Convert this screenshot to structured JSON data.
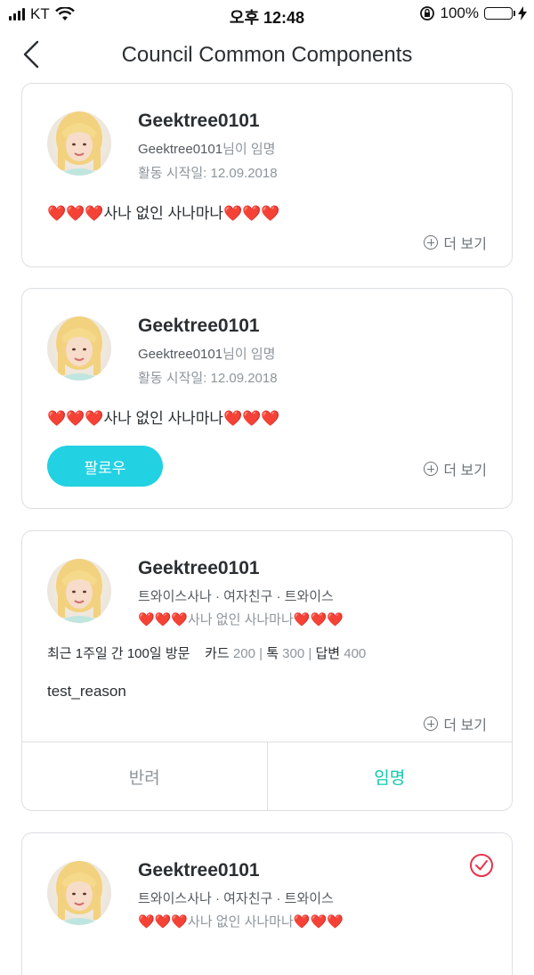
{
  "status_bar": {
    "carrier": "KT",
    "time": "오후 12:48",
    "battery": "100%",
    "icons": [
      "signal-icon",
      "wifi-icon",
      "orientation-lock-icon",
      "battery-icon",
      "charging-icon"
    ]
  },
  "nav": {
    "title": "Council Common Components",
    "back_icon": "chevron-left-icon"
  },
  "cards": [
    {
      "name": "Geektree0101",
      "appointed_by": "Geektree0101",
      "appointed_suffix": "님이 임명",
      "activity_start": "활동 시작일: 12.09.2018",
      "description": "❤️❤️❤️사나 없인 사나마나❤️❤️❤️",
      "more_label": "더 보기"
    },
    {
      "name": "Geektree0101",
      "appointed_by": "Geektree0101",
      "appointed_suffix": "님이 임명",
      "activity_start": "활동 시작일: 12.09.2018",
      "description": "❤️❤️❤️사나 없인 사나마나❤️❤️❤️",
      "follow_label": "팔로우",
      "more_label": "더 보기"
    },
    {
      "name": "Geektree0101",
      "tags": "트와이스사나 · 여자친구 · 트와이스",
      "bio": "❤️❤️❤️사나 없인 사나마나❤️❤️❤️",
      "stats": {
        "visits": "최근 1주일 간 100일 방문",
        "card_label": "카드",
        "card_value": "200",
        "talk_label": "톡",
        "talk_value": "300",
        "answer_label": "답변",
        "answer_value": "400",
        "separator": "|"
      },
      "reason": "test_reason",
      "more_label": "더 보기",
      "reject_label": "반려",
      "appoint_label": "임명"
    },
    {
      "name": "Geektree0101",
      "tags": "트와이스사나 · 여자친구 · 트와이스",
      "bio": "❤️❤️❤️사나 없인 사나마나❤️❤️❤️",
      "check_icon": "check-circle-icon"
    }
  ],
  "colors": {
    "accent_cyan": "#22d1e2",
    "accent_green": "#10c9ae",
    "heart_red": "#e4222f",
    "check_red": "#e8334a"
  }
}
